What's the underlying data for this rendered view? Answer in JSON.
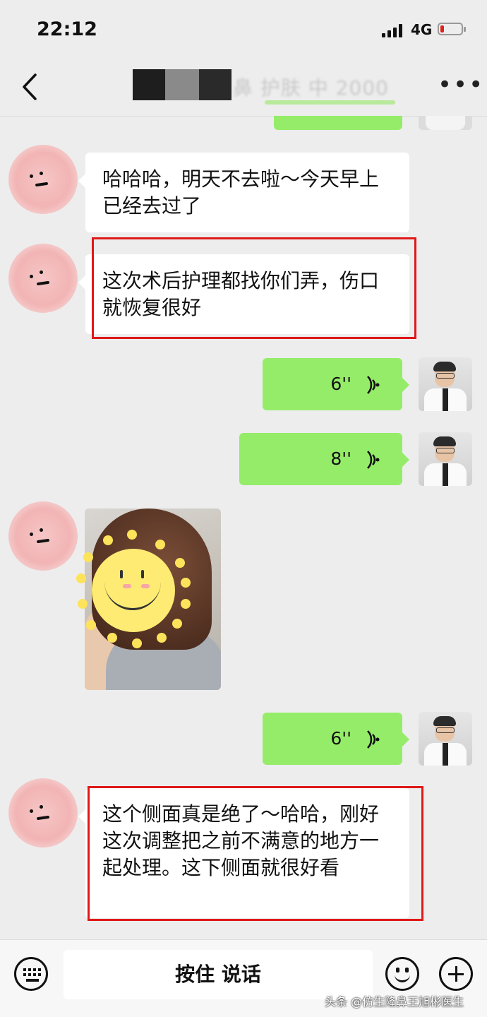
{
  "status": {
    "time": "22:12",
    "network": "4G"
  },
  "header": {
    "title_visible": "鼻 护肤 中 2000",
    "back_icon": "chevron-left-icon",
    "more_icon": "more-dots-icon"
  },
  "messages": [
    {
      "from": "friend",
      "text": "哈哈哈，明天不去啦～今天早上已经去过了"
    },
    {
      "from": "friend",
      "text": "这次术后护理都找你们弄，伤口就恢复很好",
      "highlighted": true
    },
    {
      "from": "me",
      "type": "voice",
      "duration": "6''"
    },
    {
      "from": "me",
      "type": "voice",
      "duration": "8''"
    },
    {
      "from": "friend",
      "type": "image",
      "description": "photo-with-sun-sticker"
    },
    {
      "from": "me",
      "type": "voice",
      "duration": "6''"
    },
    {
      "from": "friend",
      "text": "这个侧面真是绝了～哈哈，刚好这次调整把之前不满意的地方一起处理。这下侧面就很好看",
      "highlighted": true
    }
  ],
  "input_bar": {
    "hold_to_talk": "按住 说话"
  },
  "watermark": "头条 @仿生隆鼻王旭彬医生",
  "colors": {
    "bubble_me": "#95ec69",
    "bubble_friend": "#ffffff",
    "highlight": "#e01818",
    "background": "#ededed"
  }
}
